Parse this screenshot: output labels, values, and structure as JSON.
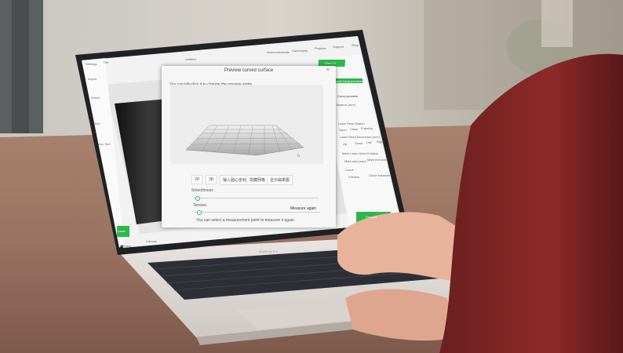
{
  "app": {
    "title": "Untitled",
    "top_nav": [
      "Announcements",
      "Community",
      "Projects",
      "Support",
      "Shop"
    ],
    "menu": [
      "Settings",
      "File"
    ],
    "left_tools": [
      "Import",
      "Select",
      "Text",
      "Arc Tool"
    ],
    "bottom_left_btns": [
      "Laser",
      "Preview"
    ],
    "right_panel": {
      "header": "xTool F1",
      "laser_head_btn": "Laser head preview",
      "curve_process": "Curve process",
      "distance_label": "Distance (mm)",
      "laser_head_switch": "Laser Head Switch",
      "switch_opts": [
        "Open",
        "Close",
        "Framing"
      ],
      "laser_movement": "Laser Head Movement (mm)",
      "move_opts": [
        "Up",
        "Down",
        "Left",
        "Right"
      ],
      "mark_position": "Mark Laser Head Position",
      "mark_opts": [
        "Mark start point",
        "Mark end point"
      ],
      "curve_label": "Curve",
      "curve_opts": [
        "Preview",
        "Curve measure"
      ],
      "process_btn": "Process"
    },
    "canvas_tab": "Canvas",
    "laptop_brand": "MacBook Pro"
  },
  "dialog": {
    "title": "Preview curved surface",
    "close_glyph": "×",
    "hint": "You can left-click it to change the preview angle.",
    "tabs": [
      "2D",
      "3D",
      "输入圆心坐标",
      "隐藏网格",
      "显示曲率图"
    ],
    "smoothness_label": "Smoothness",
    "smoothness_value": 0.02,
    "tension_label": "Tension",
    "tension_value": 0.02,
    "footer_text": "You can select a measurement point to measure it again.",
    "measure_again": "Measure again"
  },
  "colors": {
    "accent": "#2db84b",
    "dialog_bg": "#f6f6f6"
  }
}
